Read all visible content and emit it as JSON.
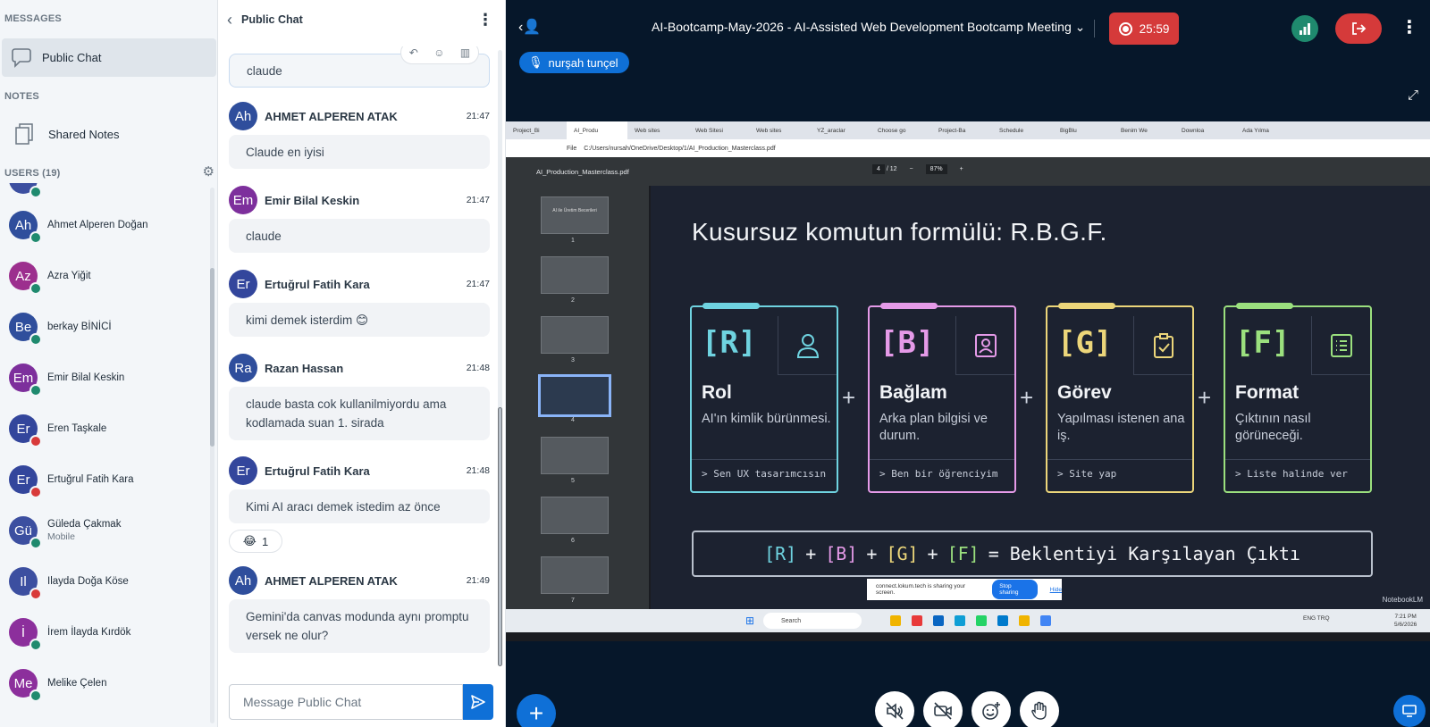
{
  "sidebar": {
    "messages_heading": "MESSAGES",
    "public_chat_label": "Public Chat",
    "notes_heading": "NOTES",
    "shared_notes_label": "Shared Notes",
    "users_heading": "USERS (19)",
    "users": [
      {
        "initials": "Ah",
        "name": "Ahmet Alperen Doğan",
        "sub": "",
        "color": "#2f4e9c",
        "status": "green"
      },
      {
        "initials": "Az",
        "name": "Azra Yiğit",
        "sub": "",
        "color": "#9c2f8e",
        "status": "green"
      },
      {
        "initials": "Be",
        "name": "berkay BİNİCİ",
        "sub": "",
        "color": "#2f4e9c",
        "status": "green"
      },
      {
        "initials": "Em",
        "name": "Emir Bilal Keskin",
        "sub": "",
        "color": "#7d2f9c",
        "status": "green"
      },
      {
        "initials": "Er",
        "name": "Eren Taşkale",
        "sub": "",
        "color": "#33469c",
        "status": "red"
      },
      {
        "initials": "Er",
        "name": "Ertuğrul Fatih Kara",
        "sub": "",
        "color": "#33469c",
        "status": "red"
      },
      {
        "initials": "Gü",
        "name": "Güleda Çakmak",
        "sub": "Mobile",
        "color": "#3c4fa0",
        "status": "green"
      },
      {
        "initials": "Il",
        "name": "Ilayda Doğa Köse",
        "sub": "",
        "color": "#3c4fa0",
        "status": "red"
      },
      {
        "initials": "İ",
        "name": "İrem İlayda Kırdök",
        "sub": "",
        "color": "#8c2f9c",
        "status": "green"
      },
      {
        "initials": "Me",
        "name": "Melike Çelen",
        "sub": "",
        "color": "#8c2f9c",
        "status": "green"
      }
    ]
  },
  "chat": {
    "title": "Public Chat",
    "first_bubble": "claude",
    "messages": [
      {
        "initials": "Ah",
        "name": "AHMET ALPEREN ATAK",
        "time": "21:47",
        "text": "Claude en iyisi",
        "color": "#2f4e9c"
      },
      {
        "initials": "Em",
        "name": "Emir Bilal Keskin",
        "time": "21:47",
        "text": "claude",
        "color": "#7d2f9c"
      },
      {
        "initials": "Er",
        "name": "Ertuğrul Fatih Kara",
        "time": "21:47",
        "text": "kimi demek isterdim 😊",
        "color": "#33469c"
      },
      {
        "initials": "Ra",
        "name": "Razan Hassan",
        "time": "21:48",
        "text": "claude basta cok kullanilmiyordu ama kodlamada suan 1. sirada",
        "color": "#2f4e9c"
      },
      {
        "initials": "Er",
        "name": "Ertuğrul Fatih Kara",
        "time": "21:48",
        "text": "Kimi AI aracı demek istedim az önce",
        "color": "#33469c"
      },
      {
        "initials": "Ah",
        "name": "AHMET ALPEREN ATAK",
        "time": "21:49",
        "text": "Gemini'da canvas modunda aynı promptu versek ne olur?",
        "color": "#2f4e9c"
      }
    ],
    "reaction_emoji": "😂",
    "reaction_count": "1",
    "input_placeholder": "Message Public Chat"
  },
  "meeting": {
    "title": "AI-Bootcamp-May-2026 - AI-Assisted Web Development Bootcamp Meeting",
    "recording_time": "25:59",
    "talker": "nurşah tunçel",
    "browser_tabs": [
      "Project_Bi",
      "AI_Produ",
      "Web sites",
      "Web Sitesi",
      "Web sites",
      "YZ_araclar",
      "Choose go",
      "Project-Ba",
      "Schedule",
      "BigBlu",
      "Benim We",
      "Downloa",
      "Ada Yılma"
    ],
    "browser_file_label": "File",
    "browser_address": "C:/Users/nursah/OneDrive/Desktop/1/AI_Production_Masterclass.pdf",
    "pdf_filename": "AI_Production_Masterclass.pdf",
    "pdf_page": "4",
    "pdf_total": "/ 12",
    "pdf_zoom": "87%",
    "thumb_numbers": [
      "1",
      "2",
      "3",
      "4",
      "5",
      "6",
      "7"
    ],
    "first_thumb_title": "AI ile Üretim Becerileri",
    "share_text": "connect.lokum.tech is sharing your screen.",
    "stop_sharing": "Stop sharing",
    "hide": "Hide",
    "taskbar_search": "Search",
    "taskbar_lang": "ENG TRQ",
    "taskbar_time": "7:21 PM",
    "taskbar_date": "5/6/2026",
    "watermark": "NotebookLM"
  },
  "slide": {
    "title": "Kusursuz komutun formülü: R.B.G.F.",
    "cards": [
      {
        "code": "[R]",
        "name": "Rol",
        "desc": "AI'ın kimlik bürünmesi.",
        "example": "> Sen UX tasarımcısın",
        "color": "#6fd3e0",
        "icon": "user-icon"
      },
      {
        "code": "[B]",
        "name": "Bağlam",
        "desc": "Arka plan bilgisi ve durum.",
        "example": "> Ben bir öğrenciyim",
        "color": "#e59ae8",
        "icon": "id-card-icon"
      },
      {
        "code": "[G]",
        "name": "Görev",
        "desc": "Yapılması istenen ana iş.",
        "example": "> Site yap",
        "color": "#ecd67a",
        "icon": "clipboard-check-icon"
      },
      {
        "code": "[F]",
        "name": "Format",
        "desc": "Çıktının nasıl görüneceği.",
        "example": "> Liste halinde ver",
        "color": "#9be07e",
        "icon": "list-icon"
      }
    ],
    "plus": "+",
    "formula": [
      "[R]",
      "+",
      "[B]",
      "+",
      "[G]",
      "+",
      "[F]",
      "= Beklentiyi Karşılayan Çıktı"
    ]
  }
}
